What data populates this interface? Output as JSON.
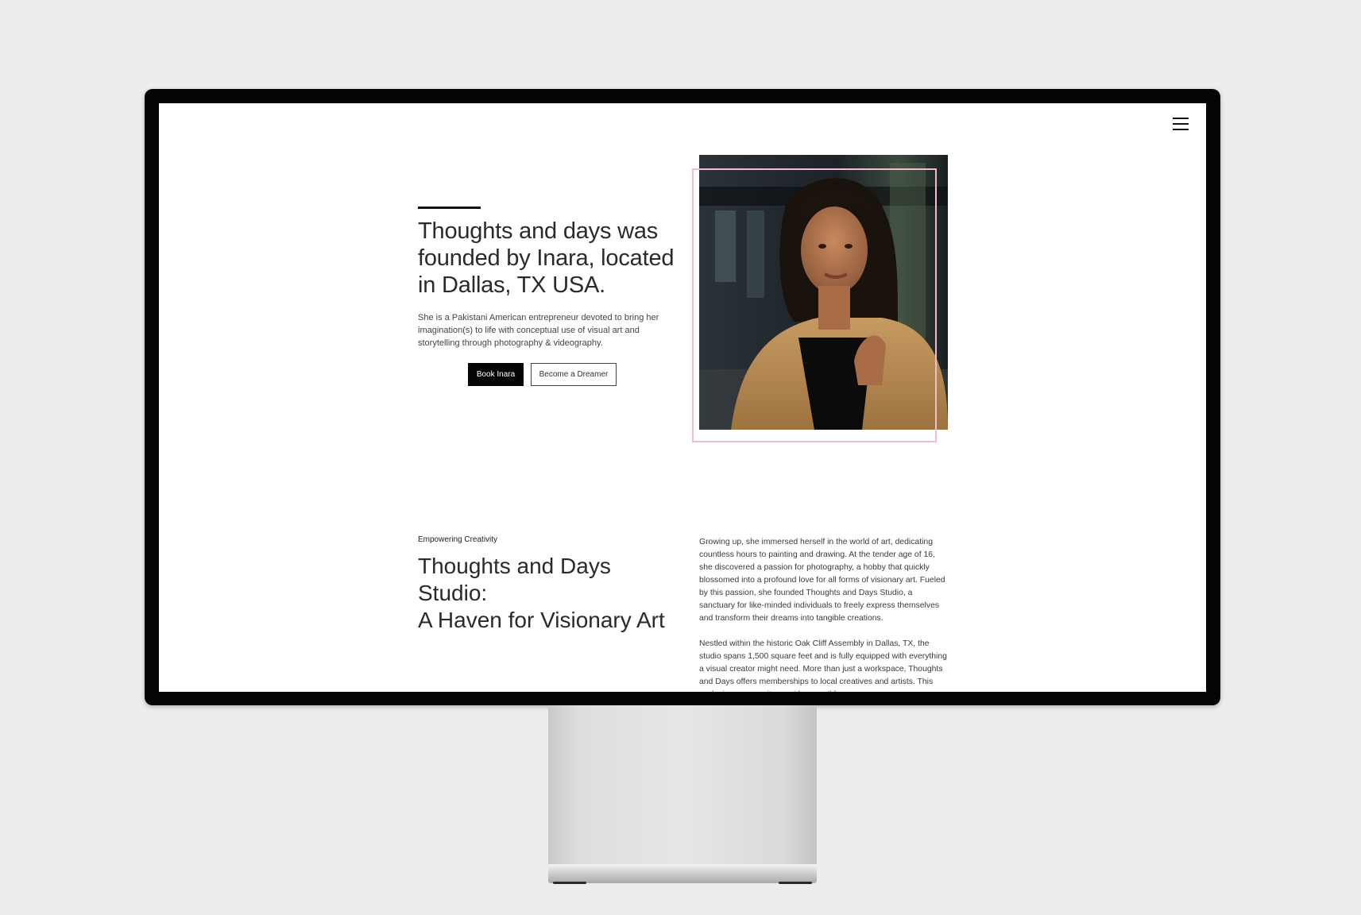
{
  "hero": {
    "title": "Thoughts and days was founded by Inara, located in Dallas, TX USA.",
    "description": "She is a Pakistani American entrepreneur devoted to bring her imagination(s) to life with conceptual use of visual art and storytelling through photography & videography.",
    "book_button": "Book Inara",
    "dreamer_button": "Become a Dreamer"
  },
  "section": {
    "eyebrow": "Empowering Creativity",
    "title_line1": "Thoughts and Days",
    "title_line2": "Studio:",
    "title_line3": "A Haven for Visionary Art",
    "paragraph1": "Growing up, she immersed herself in the world of art, dedicating countless hours to painting and drawing. At the tender age of 16, she discovered a passion for photography, a hobby that quickly blossomed into a profound love for all forms of visionary art. Fueled by this passion, she founded Thoughts and Days Studio, a sanctuary for like-minded individuals to freely express themselves and transform their dreams into tangible creations.",
    "paragraph2": "Nestled within the historic Oak Cliff Assembly in Dallas, TX, the studio spans 1,500 square feet and is fully equipped with everything a visual creator might need. More than just a workspace, Thoughts and Days offers memberships to local creatives and artists. This exclusive community provides monthly"
  },
  "colors": {
    "frame_accent": "#f2bcd0",
    "button_primary": "#050505",
    "monitor_bezel": "#050505"
  },
  "icons": {
    "menu": "hamburger-menu-icon"
  }
}
